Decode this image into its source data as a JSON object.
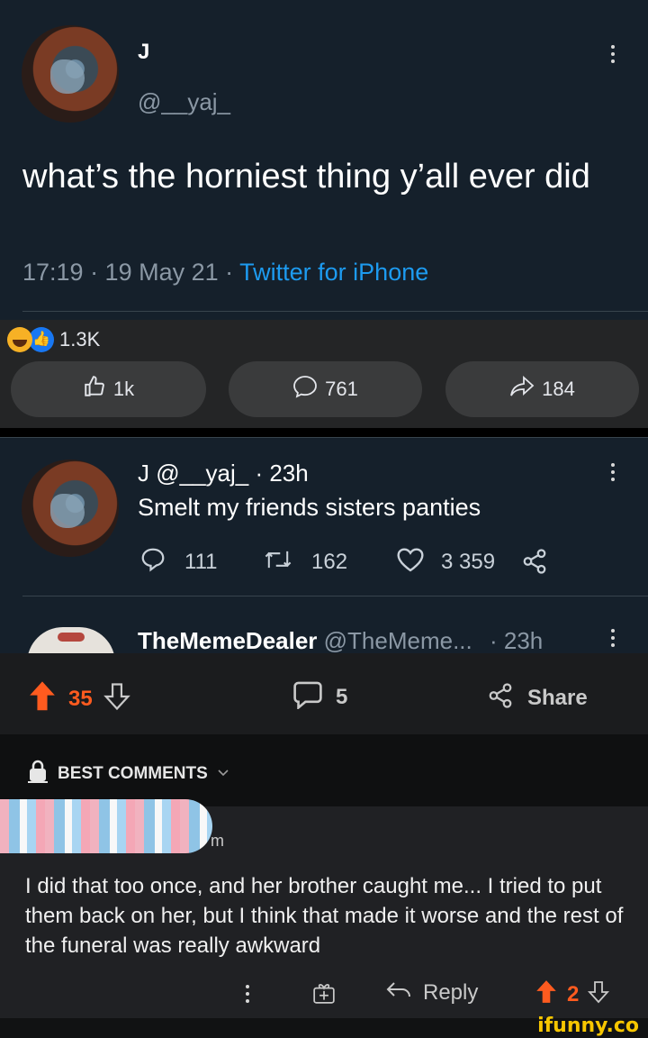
{
  "tweet": {
    "display_name": "J",
    "handle": "@__yaj_",
    "text": "what’s the horniest thing y’all ever did",
    "time_date": "17:19 · 19 May 21 · ",
    "source": "Twitter for iPhone"
  },
  "facebook_bar": {
    "reaction_count": "1.3K",
    "like_count": "1k",
    "comment_count": "761",
    "share_count": "184"
  },
  "reply_tweet": {
    "header": "J @__yaj_ · 23h",
    "text": "Smelt my friends sisters panties",
    "reply_count": "111",
    "retweet_count": "162",
    "like_count": "3 359"
  },
  "next_tweet": {
    "display_name": "TheMemeDealer",
    "handle": "@TheMeme...",
    "time": "· 23h"
  },
  "ifunny": {
    "upvotes": "35",
    "comments": "5",
    "share_label": "Share",
    "best_comments_label": "BEST COMMENTS",
    "comment_user_tail": "m",
    "comment_text": "I did that too once, and her brother caught me... I tried to put them back on her, but I think that made it worse and the rest of the funeral was really awkward",
    "reply_label": "Reply",
    "comment_score": "2",
    "watermark": "ifunny.co"
  },
  "colors": {
    "twitter_bg": "#15202b",
    "link_blue": "#1d9bf0",
    "ifunny_orange": "#ff5b1f",
    "fb_pill": "#3a3b3c"
  }
}
